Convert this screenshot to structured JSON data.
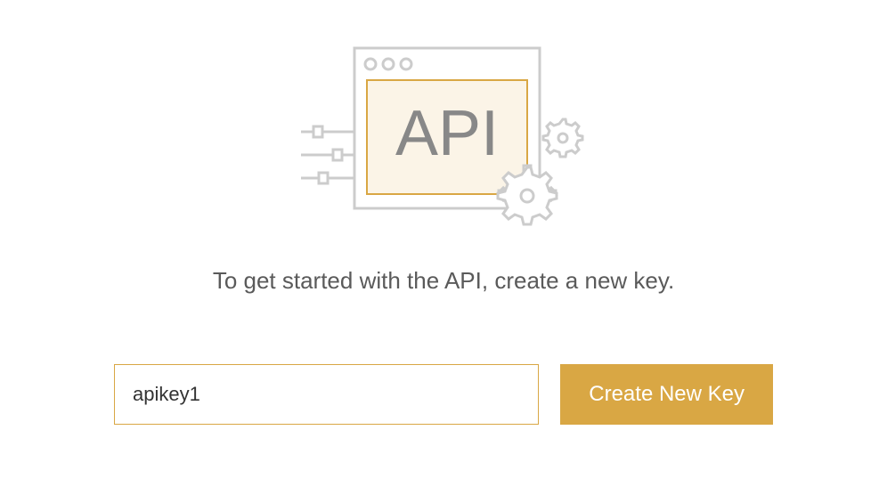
{
  "illustration": {
    "api_label": "API",
    "icon_name": "api-window-gears-icon"
  },
  "instruction": "To get started with the API, create a new key.",
  "form": {
    "key_input_value": "apikey1",
    "key_input_placeholder": "",
    "create_button_label": "Create New Key"
  },
  "colors": {
    "accent": "#d9a744",
    "text_muted": "#5a5a5a",
    "window_fill": "#fbf4e7",
    "stroke": "#cccccc"
  }
}
